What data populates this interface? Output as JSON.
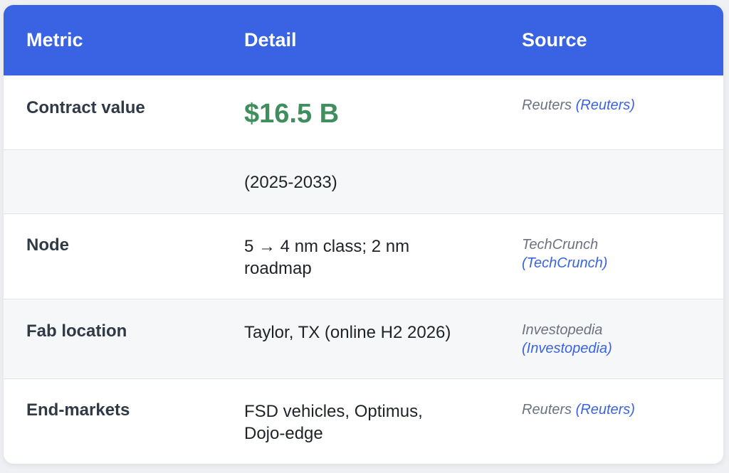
{
  "header": {
    "metric": "Metric",
    "detail": "Detail",
    "source": "Source"
  },
  "rows": [
    {
      "metric": "Contract value",
      "detail": "$16.5 B",
      "source_name": "Reuters",
      "source_link": "(Reuters)"
    },
    {
      "metric": "",
      "detail": "(2025-2033)",
      "source_name": "",
      "source_link": ""
    },
    {
      "metric": "Node",
      "detail": "5 → 4 nm class; 2 nm roadmap",
      "source_name": "TechCrunch",
      "source_link": "(TechCrunch)"
    },
    {
      "metric": "Fab location",
      "detail": "Taylor, TX (online H2 2026)",
      "source_name": "Investopedia",
      "source_link": "(Investopedia)"
    },
    {
      "metric": "End-markets",
      "detail": "FSD vehicles, Optimus, Dojo-edge",
      "source_name": "Reuters",
      "source_link": "(Reuters)"
    }
  ],
  "colors": {
    "header_bg": "#3a63e3",
    "accent_value": "#3f8f5e",
    "link": "#3a63e3"
  }
}
